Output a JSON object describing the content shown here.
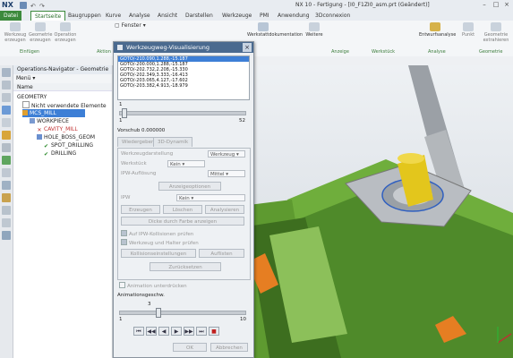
{
  "app": {
    "logo": "NX",
    "window_title": "NX 10 - Fertigung - [I0_F1ZI0_asm.prt (Geändert)]"
  },
  "tabs": [
    "Datei",
    "Startseite",
    "Baugruppen",
    "Kurve",
    "Analyse",
    "Ansicht",
    "Darstellen",
    "Werkzeuge",
    "PMI",
    "Anwendung",
    "3Dconnexion"
  ],
  "active_tab": "Startseite",
  "ribbon": {
    "fenster_label": "Fenster",
    "buttons": [
      "Werkzeug erzeugen",
      "Geometrie erzeugen",
      "Operation erzeugen",
      "Werkstattdokumentation",
      "Weitere",
      "Entwurfsanalyse",
      "Punkt",
      "Geometrie extrahieren"
    ],
    "groups": [
      "Einfügen",
      "Aktion",
      "Anzeige",
      "Werkstück",
      "Analyse",
      "Geometrie"
    ]
  },
  "navigator": {
    "title": "Operations-Navigator - Geometrie",
    "menu_label": "Menü",
    "column_header": "Name",
    "items": [
      {
        "label": "GEOMETRY",
        "indent": 0
      },
      {
        "label": "Nicht verwendete Elemente",
        "indent": 1
      },
      {
        "label": "MCS_MILL",
        "indent": 1
      },
      {
        "label": "WORKPIECE",
        "indent": 2
      },
      {
        "label": "CAVITY_MILL",
        "indent": 3
      },
      {
        "label": "HOLE_BOSS_GEOM",
        "indent": 3
      },
      {
        "label": "SPOT_DRILLING",
        "indent": 4
      },
      {
        "label": "DRILLING",
        "indent": 4
      }
    ]
  },
  "dialog": {
    "title": "Werkzeugweg-Visualisierung",
    "close_label": "×",
    "goto_lines": [
      "GOTO/-210.090,1.288,-15.187",
      "GOTO/-200.000,1.288,-15.187",
      "GOTO/-202.732,2.208,-15.330",
      "GOTO/-202.349,3.333,-16.413",
      "GOTO/-203.065,4.127,-17.602",
      "GOTO/-203.382,4.913,-18.979"
    ],
    "slider1": {
      "min": "1",
      "max": "52",
      "value_label": "1",
      "position": 0.02
    },
    "feed_label": "Vorschub 0.000000",
    "subtabs": [
      "Wiedergeben",
      "3D-Dynamik"
    ],
    "fields": [
      {
        "label": "Werkzeugdarstellung",
        "value": "Werkzeug"
      },
      {
        "label": "Werkstück",
        "value": "Kein"
      },
      {
        "label": "IPW-Auflösung",
        "value": "Mittel"
      }
    ],
    "btn_options": "Anzeigeoptionen",
    "ipw_label": "IPW",
    "ipw_value": "Kein",
    "btn_row": [
      "Erzeugen",
      "Löschen",
      "Analysieren"
    ],
    "btn_thick": "Dicke durch Farbe anzeigen",
    "check1": "Auf IPW-Kollisionen prüfen",
    "check2": "Werkzeug und Halter prüfen",
    "btn_collision": "Kollisionseinstellungen",
    "btn_list": "Auflisten",
    "btn_reset": "Zurücksetzen",
    "check3": "Animation unterdrücken",
    "anim_label": "Animationsgeschw.",
    "slider2": {
      "min": "1",
      "max": "10",
      "value_label": "3",
      "position": 0.3
    },
    "playback": [
      "⏮",
      "◀◀",
      "◀",
      "▶",
      "▶▶",
      "⏭",
      "■"
    ],
    "ok": "OK",
    "cancel": "Abbrechen"
  }
}
